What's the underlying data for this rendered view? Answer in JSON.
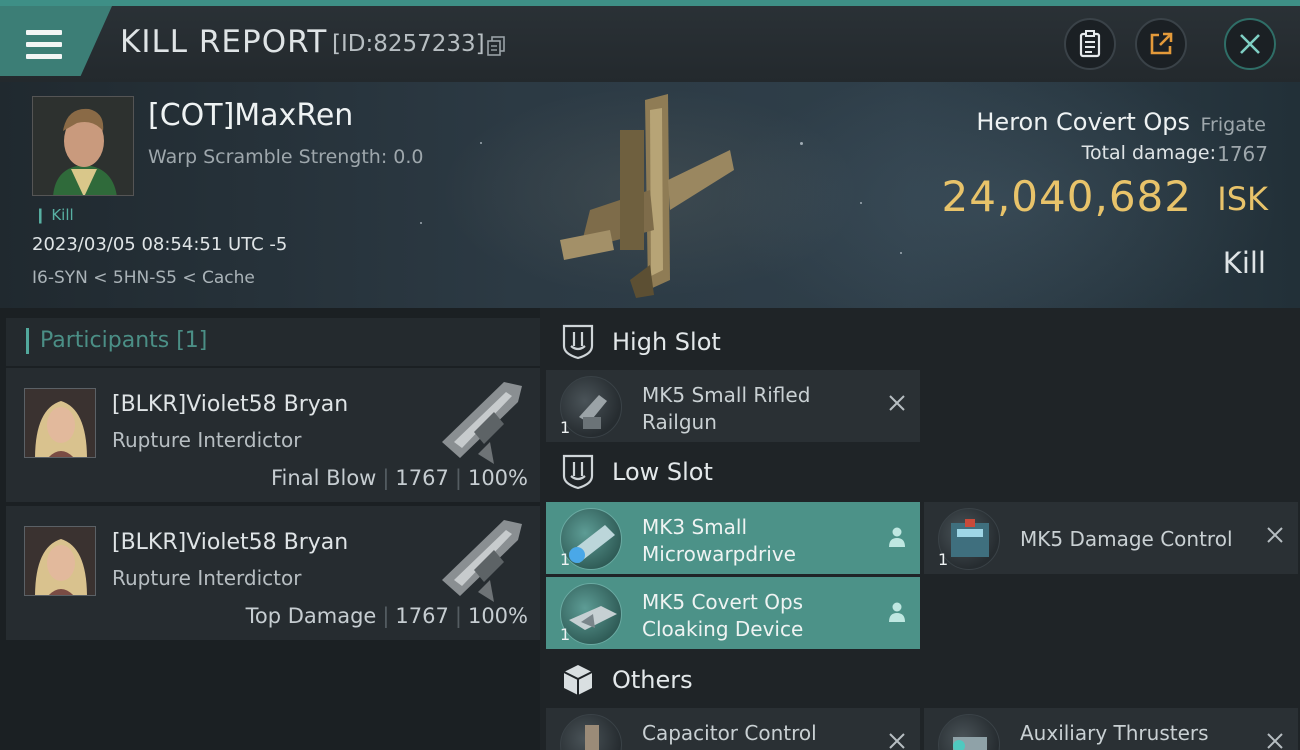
{
  "header": {
    "title": "KILL REPORT",
    "report_id": "[ID:8257233]",
    "menu_icon": "hamburger-menu-icon",
    "buttons": [
      "clipboard-icon",
      "share-icon",
      "close-icon"
    ]
  },
  "victim": {
    "pilot_name": "[COT]MaxRen",
    "warp_scramble": "Warp Scramble Strength: 0.0",
    "kill_tag": "Kill",
    "time": "2023/03/05 08:54:51 UTC -5",
    "location": "I6-SYN < 5HN-S5 < Cache",
    "ship_name": "Heron Covert Ops",
    "ship_class": "Frigate",
    "total_damage_label": "Total damage:",
    "total_damage": "1767",
    "isk_value": "24,040,682",
    "isk_unit": "ISK",
    "result": "Kill"
  },
  "participants": {
    "title": "Participants [1]",
    "items": [
      {
        "name": "[BLKR]Violet58 Bryan",
        "ship": "Rupture Interdictor",
        "role": "Final Blow",
        "damage": "1767",
        "percent": "100%"
      },
      {
        "name": "[BLKR]Violet58 Bryan",
        "ship": "Rupture Interdictor",
        "role": "Top Damage",
        "damage": "1767",
        "percent": "100%"
      }
    ]
  },
  "fittings": {
    "high_slot": {
      "title": "High Slot",
      "modules": [
        {
          "name_line1": "MK5 Small Rifled",
          "name_line2": "Railgun",
          "qty": "1",
          "active": false,
          "action": "remove"
        }
      ]
    },
    "low_slot": {
      "title": "Low Slot",
      "modules": [
        {
          "name_line1": "MK3 Small",
          "name_line2": "Microwarpdrive",
          "qty": "1",
          "active": true,
          "action": "person"
        },
        {
          "name_line1": "MK5 Damage Control",
          "name_line2": "",
          "qty": "1",
          "active": false,
          "action": "remove"
        },
        {
          "name_line1": "MK5 Covert Ops",
          "name_line2": "Cloaking Device",
          "qty": "1",
          "active": true,
          "action": "person"
        }
      ]
    },
    "others": {
      "title": "Others",
      "modules": [
        {
          "name_line1": "Capacitor Control",
          "name_line2": "",
          "qty": "",
          "active": false,
          "action": "remove"
        },
        {
          "name_line1": "Auxiliary Thrusters",
          "name_line2": "",
          "qty": "",
          "active": false,
          "action": "remove"
        }
      ]
    }
  },
  "colors": {
    "accent_teal": "#4c9288",
    "isk_gold": "#e8c36a",
    "header_teal": "#3c7e76"
  }
}
